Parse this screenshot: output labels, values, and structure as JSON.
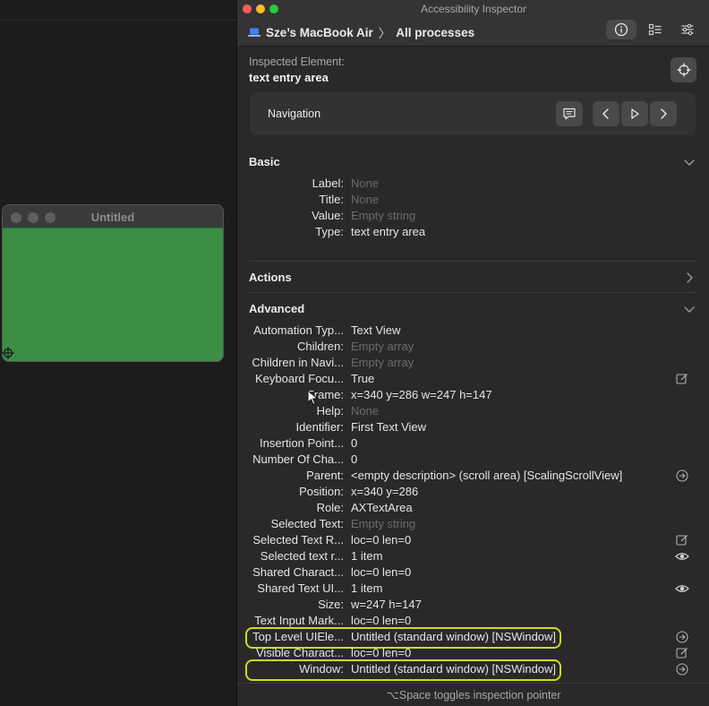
{
  "desktop": {
    "untitled_window": {
      "title": "Untitled",
      "fill_color": "#3b8f45"
    }
  },
  "inspector": {
    "window_title": "Accessibility Inspector",
    "breadcrumb": {
      "device": "Sze’s MacBook Air",
      "separator": "〉",
      "scope": "All processes"
    },
    "toolbar_icons": [
      "info-icon",
      "list-icon",
      "settings-sliders-icon"
    ],
    "inspected_label": "Inspected Element:",
    "inspected_name": "text entry area",
    "navigation": {
      "label": "Navigation"
    },
    "basic": {
      "header": "Basic",
      "rows": [
        {
          "key": "Label:",
          "value": "None",
          "dim": true
        },
        {
          "key": "Title:",
          "value": "None",
          "dim": true
        },
        {
          "key": "Value:",
          "value": "Empty string",
          "dim": true
        },
        {
          "key": "Type:",
          "value": "text entry area",
          "dim": false
        }
      ]
    },
    "actions": {
      "header": "Actions"
    },
    "advanced": {
      "header": "Advanced",
      "rows": [
        {
          "key": "Automation Typ...",
          "value": "Text View",
          "dim": false
        },
        {
          "key": "Children:",
          "value": "Empty array",
          "dim": true
        },
        {
          "key": "Children in Navi...",
          "value": "Empty array",
          "dim": true
        },
        {
          "key": "Keyboard Focu...",
          "value": "True",
          "dim": false,
          "icon": "edit-icon"
        },
        {
          "key": "Frame:",
          "value": "x=340 y=286 w=247 h=147",
          "dim": false
        },
        {
          "key": "Help:",
          "value": "None",
          "dim": true
        },
        {
          "key": "Identifier:",
          "value": "First Text View",
          "dim": false
        },
        {
          "key": "Insertion Point...",
          "value": "0",
          "dim": false
        },
        {
          "key": "Number Of Cha...",
          "value": "0",
          "dim": false
        },
        {
          "key": "Parent:",
          "value": "<empty description> (scroll area) [ScalingScrollView]",
          "dim": false,
          "icon": "go-arrow-icon"
        },
        {
          "key": "Position:",
          "value": "x=340 y=286",
          "dim": false
        },
        {
          "key": "Role:",
          "value": "AXTextArea",
          "dim": false
        },
        {
          "key": "Selected Text:",
          "value": "Empty string",
          "dim": true
        },
        {
          "key": "Selected Text R...",
          "value": "loc=0 len=0",
          "dim": false,
          "icon": "edit-icon"
        },
        {
          "key": "Selected text r...",
          "value": "1 item",
          "dim": false,
          "icon": "eye-icon"
        },
        {
          "key": "Shared Charact...",
          "value": "loc=0 len=0",
          "dim": false
        },
        {
          "key": "Shared Text UI...",
          "value": "1 item",
          "dim": false,
          "icon": "eye-icon"
        },
        {
          "key": "Size:",
          "value": "w=247 h=147",
          "dim": false
        },
        {
          "key": "Text Input Mark...",
          "value": "loc=0 len=0",
          "dim": false
        },
        {
          "key": "Top Level UIEle...",
          "value": "Untitled (standard window) [NSWindow]",
          "dim": false,
          "icon": "go-arrow-icon",
          "highlighted": true
        },
        {
          "key": "Visible Charact...",
          "value": "loc=0 len=0",
          "dim": false,
          "icon": "edit-icon"
        },
        {
          "key": "Window:",
          "value": "Untitled (standard window) [NSWindow]",
          "dim": false,
          "icon": "go-arrow-icon",
          "highlighted": true
        }
      ]
    },
    "footer": "⌥Space toggles inspection pointer",
    "highlight_color": "#c5e01f"
  }
}
